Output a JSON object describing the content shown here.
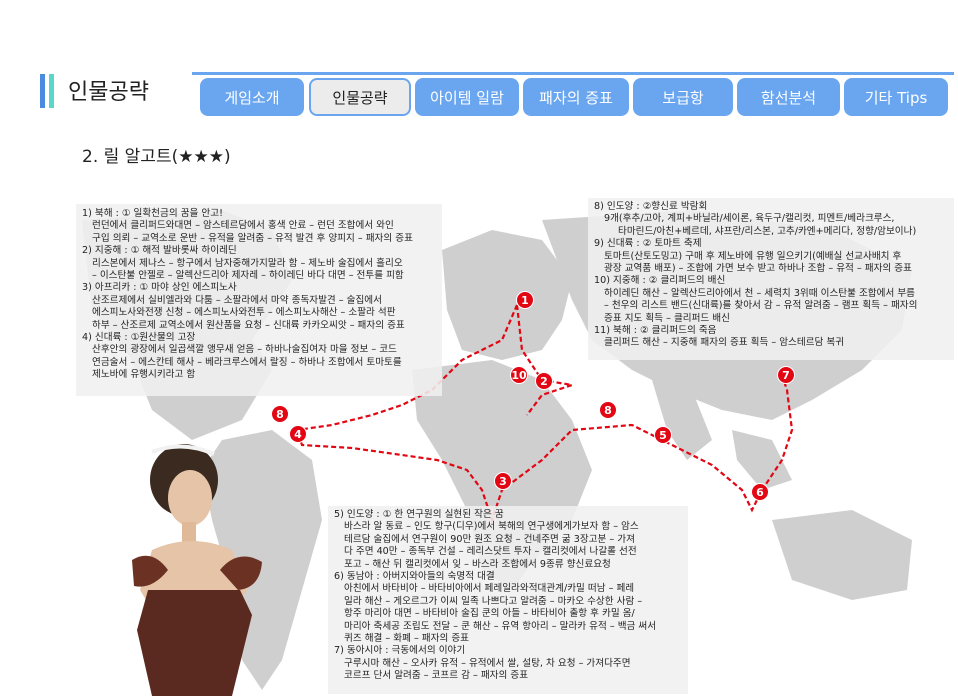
{
  "header": {
    "title": "인물공략"
  },
  "tabs": [
    {
      "label": "게임소개"
    },
    {
      "label": "인물공략"
    },
    {
      "label": "아이템 일람"
    },
    {
      "label": "패자의 증표"
    },
    {
      "label": "보급항"
    },
    {
      "label": "함선분석"
    },
    {
      "label": "기타 Tips"
    }
  ],
  "active_tab": "인물공략",
  "section": {
    "title": "2. 릴 알고트(★★★)"
  },
  "box_left": {
    "lines": [
      "1) 북해 : ① 일확천금의 꿈을 안고!",
      "런던에서 클리퍼드와대면 – 암스테르담에서 홍색 안료 – 런던 조합에서 와인",
      "구입 의뢰 – 교역소로 운반 – 유적을 알려줌 – 유적 발견 후 양피지 – 패자의 증표",
      "2) 지중해 : ① 해적 발바롯싸 하이레딘",
      "리스본에서 제나스 – 항구에서 남자중해가지말라 함 – 제노바 술집에서 흘리오",
      "– 이스탄불 안젤로 – 알렉산드리아 제자레 – 하이레딘 바다 대면 – 전투를 피함",
      "3) 아프리카 : ① 마야 상인 에스피노사",
      "산조르제에서 실비엘라와 다툼 – 소팔라에서 마약 종독자발견 – 술집에서",
      "에스피노사와전쟁 신청 – 에스피노사와전투 – 에스피노사해산 – 소팔라 석판",
      "하부 – 산조르제 교역소에서 원산품을 요청 – 신대륙 카카오씨앗 – 패자의 증표",
      "4) 신대륙 : ①원산물의 고장",
      "산후안의 광장에서 일곱색깔 앵무새 얻음 – 하바나술집여자 마을 정보 – 코드",
      "연금술서 – 에스칸테 해사 – 베라크루스에서 랄징 – 하바나 조합에서 토마토를",
      "제노바에 유행시키라고 함"
    ]
  },
  "box_right": {
    "lines": [
      "8) 인도양 : ②향신료 박람회",
      "9개(후추/고아, 계피+바닐라/세이론, 육두구/캘리컷, 피멘트/베라크루스,",
      "타마린드/아친+베르데, 샤프란/리스본, 고추/카엔+메리다, 정향/암보이나)",
      "9) 신대륙 : ② 토마트 축제",
      "토마트(산토도밍고) 구매 후 제노바에 유행 일으키기(예배실 선교사배치 후",
      "광장 교역품 배포) – 조합에 가면 보수 받고 하바나 조합 – 유적 – 패자의 증표",
      "10) 지중해 : ② 클리퍼드의 배신",
      "하이레딘 해산 – 알렉산드리아에서 천 – 세력치 3위때 이스탄불 조합에서 부름",
      "– 천우의 리스트 밴드(신대륙)를 찾아서 감 – 유적 알려줌 – 램프 획득 – 패자의",
      "증표 지도 획득 – 클리퍼드 배신",
      "11) 북해 : ② 클리퍼드의 죽음",
      "클리퍼드 해산 – 지중해 패자의 증표 획득 – 암스테르담 복귀"
    ]
  },
  "box_bottom": {
    "lines": [
      "5) 인도양 : ① 한 연구원의 실현된 작은 꿈",
      "바스라 알 동료 – 인도 항구(디우)에서 북해의 연구생에게가보자 함 – 암스",
      "테르담 술집에서 연구원이 90만 원조 요청 – 건네주면 굶 3장고분 – 가져",
      "다 주면 40만 – 종독부 건설 – 레리스닷트 투자 – 캘리컷에서 나갈롤 선전",
      "포고 – 해산 뒤 캘리컷에서 잊 – 바스라 조합에서 9종류 향신료요청",
      "6) 동남아 : 아버지와아들의 숙명적 대결",
      "아친에서 바타비아 – 바타비아에서 페레일라와적대관계/카밀 떠남 – 페레",
      "일라 해산 – 게오르그가 이씨 일족 나쁘다고 알려줌 – 마카오 수상한 사람 –",
      "항주 마리아 대면 – 바타비아 술집 쿤의 아들 – 바타비아 출항 후 카밀 옴/",
      "마리아 축세공 조립도 전달 – 쿤 해산 – 유역 항아리 – 말라카 유적 – 백금 써서",
      "퀴즈 해결 – 화폐 – 패자의 증표",
      "7) 동아시아 : 극동에서의 이야기",
      "구루시마 해산 – 오사카 유적 – 유적에서 쌀, 설탕, 차 요청 – 가져다주면",
      "코르프 단서 알려줌 – 코프르 감 – 패자의 증표"
    ]
  },
  "markers": [
    "1",
    "2",
    "10",
    "8",
    "4",
    "3",
    "8",
    "5",
    "6",
    "7"
  ],
  "colors": {
    "tab": "#6aa6f0",
    "route": "#e30613",
    "land": "#cfcfcf"
  }
}
